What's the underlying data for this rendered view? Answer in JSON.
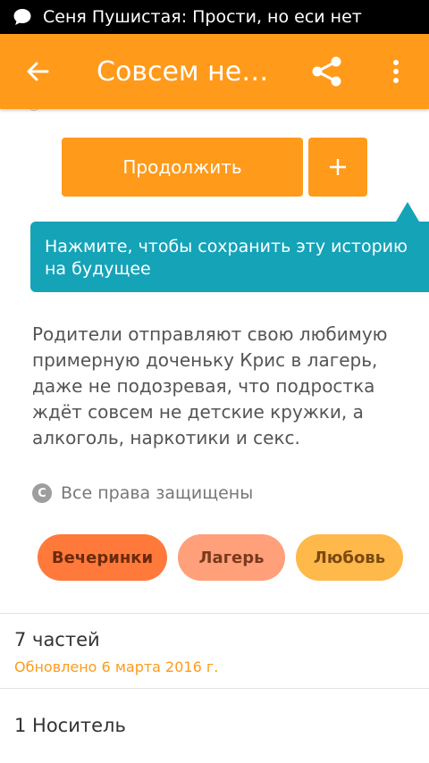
{
  "status_bar": {
    "icon": "message-icon",
    "notification": "Сеня Пушистая: Прости, но еси нет"
  },
  "app_bar": {
    "back_icon": "arrow-left-icon",
    "title": "Совсем не д...",
    "share_icon": "share-icon",
    "more_icon": "more-vertical-icon",
    "color": "#FF9A1A"
  },
  "actions": {
    "continue_label": "Продолжить",
    "add_icon": "plus-icon"
  },
  "tooltip": {
    "text": "Нажмите, чтобы сохранить эту историю на будущее",
    "color": "#15A3B8"
  },
  "story": {
    "description": "Родители отправляют свою любимую примерную доченьку Крис в лагерь, даже не подозревая, что подростка ждёт совсем не детские кружки, а алкоголь, наркотики и секс.",
    "copyright_icon": "copyright-icon",
    "copyright": "Все права защищены",
    "tags": [
      "Вечеринки",
      "Лагерь",
      "Любовь"
    ]
  },
  "parts": {
    "title": "7 частей",
    "updated": "Обновлено 6 марта 2016 г."
  },
  "media": {
    "title": "1 Носитель"
  }
}
